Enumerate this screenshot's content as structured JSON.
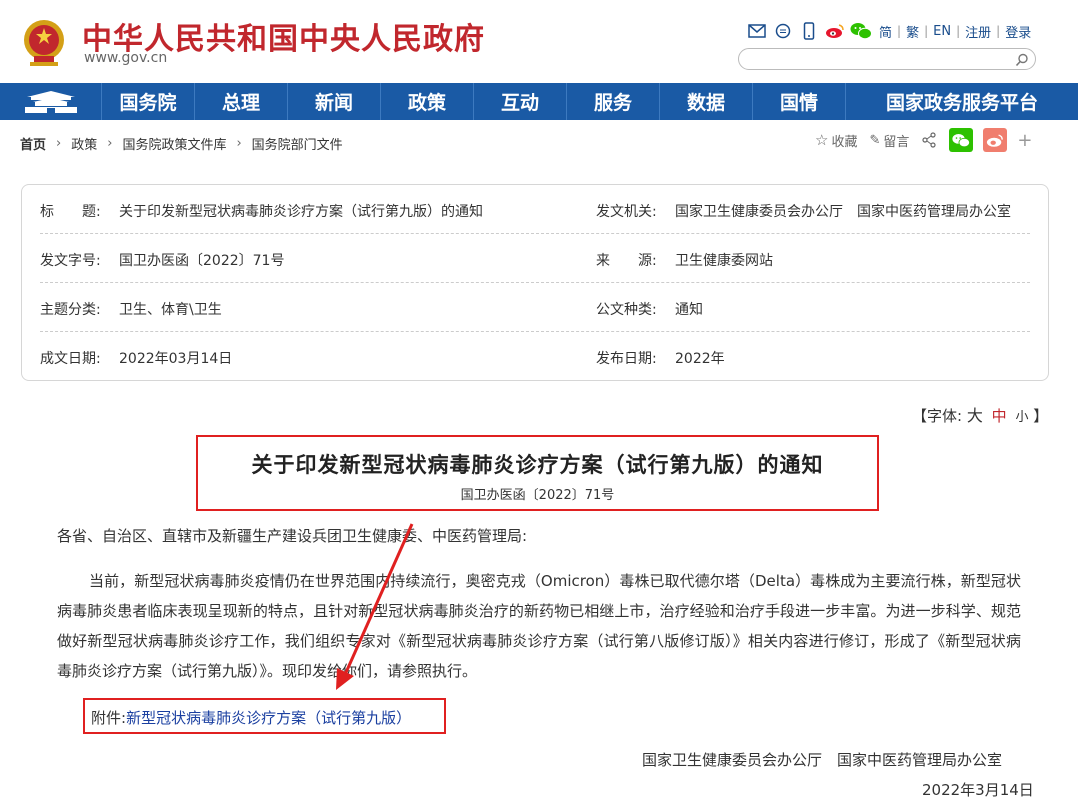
{
  "header": {
    "site_name": "中华人民共和国中央人民政府",
    "site_url": "www.gov.cn",
    "lang": {
      "simplified": "简",
      "traditional": "繁",
      "english": "EN",
      "register": "注册",
      "login": "登录"
    },
    "icons": [
      "mail-icon",
      "message-icon",
      "mobile-icon",
      "weibo-icon",
      "wechat-icon"
    ]
  },
  "nav": {
    "items": [
      "国务院",
      "总理",
      "新闻",
      "政策",
      "互动",
      "服务",
      "数据",
      "国情",
      "国家政务服务平台"
    ]
  },
  "breadcrumb": {
    "items": [
      "首页",
      "政策",
      "国务院政策文件库",
      "国务院部门文件"
    ]
  },
  "share": {
    "favorite": "收藏",
    "comment": "留言"
  },
  "info": {
    "title_label": "标　　题:",
    "title_value": "关于印发新型冠状病毒肺炎诊疗方案（试行第九版）的通知",
    "issuer_label": "发文机关:",
    "issuer_value": "国家卫生健康委员会办公厅　国家中医药管理局办公室",
    "doc_no_label": "发文字号:",
    "doc_no_value": "国卫办医函〔2022〕71号",
    "source_label": "来　　源:",
    "source_value": "卫生健康委网站",
    "category_label": "主题分类:",
    "category_value": "卫生、体育\\卫生",
    "type_label": "公文种类:",
    "type_value": "通知",
    "written_label": "成文日期:",
    "written_value": "2022年03月14日",
    "published_label": "发布日期:",
    "published_value": "2022年"
  },
  "font_size": {
    "prefix": "【字体:",
    "large": "大",
    "medium": "中",
    "small": "小",
    "suffix": "】"
  },
  "document": {
    "title": "关于印发新型冠状病毒肺炎诊疗方案（试行第九版）的通知",
    "number": "国卫办医函〔2022〕71号",
    "salutation": "各省、自治区、直辖市及新疆生产建设兵团卫生健康委、中医药管理局:",
    "paragraph": "当前，新型冠状病毒肺炎疫情仍在世界范围内持续流行，奥密克戎（Omicron）毒株已取代德尔塔（Delta）毒株成为主要流行株，新型冠状病毒肺炎患者临床表现呈现新的特点，且针对新型冠状病毒肺炎治疗的新药物已相继上市，治疗经验和治疗手段进一步丰富。为进一步科学、规范做好新型冠状病毒肺炎诊疗工作，我们组织专家对《新型冠状病毒肺炎诊疗方案（试行第八版修订版）》相关内容进行修订，形成了《新型冠状病毒肺炎诊疗方案（试行第九版）》。现印发给你们，请参照执行。",
    "attachment_label": "附件:",
    "attachment_link": "新型冠状病毒肺炎诊疗方案（试行第九版）",
    "signature": "国家卫生健康委员会办公厅　国家中医药管理局办公室",
    "date": "2022年3月14日"
  },
  "colors": {
    "brand_red": "#c1272d",
    "nav_blue": "#1a5aa5",
    "highlight_red": "#e02020",
    "link_blue": "#1a3fa0"
  }
}
